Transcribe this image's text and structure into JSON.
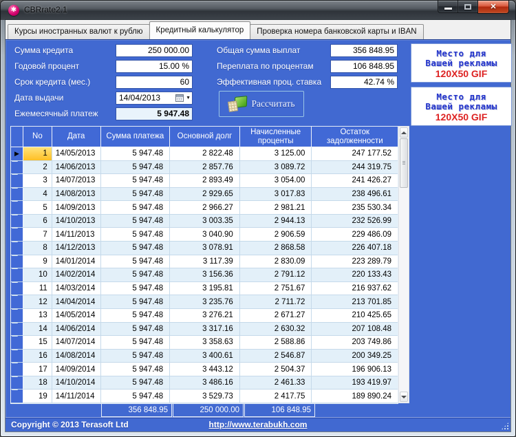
{
  "window": {
    "title": "CBRrate2.1"
  },
  "tabs": [
    {
      "label": "Курсы иностранных валют к рублю",
      "active": false
    },
    {
      "label": "Кредитный калькулятор",
      "active": true
    },
    {
      "label": "Проверка номера банковской карты и IBAN",
      "active": false
    }
  ],
  "form": {
    "left": [
      {
        "label": "Сумма кредита",
        "value": "250 000.00"
      },
      {
        "label": "Годовой процент",
        "value": "15.00 %"
      },
      {
        "label": "Срок кредита (мес.)",
        "value": "60"
      },
      {
        "label": "Дата выдачи",
        "value": "14/04/2013"
      },
      {
        "label": "Ежемесячный платеж",
        "value": "5 947.48"
      }
    ],
    "right": [
      {
        "label": "Общая сумма выплат",
        "value": "356 848.95"
      },
      {
        "label": "Переплата по процентам",
        "value": "106 848.95"
      },
      {
        "label": "Эффективная проц. ставка",
        "value": "42.74 %"
      }
    ],
    "calculate_label": "Рассчитать"
  },
  "ads": {
    "line1": "Место для",
    "line2": "Вашей рекламы",
    "line3": "120X50 GIF"
  },
  "table": {
    "columns": [
      "No",
      "Дата",
      "Сумма платежа",
      "Основной долг",
      "Начисленные проценты",
      "Остаток задолженности"
    ],
    "rows": [
      [
        "1",
        "14/05/2013",
        "5 947.48",
        "2 822.48",
        "3 125.00",
        "247 177.52"
      ],
      [
        "2",
        "14/06/2013",
        "5 947.48",
        "2 857.76",
        "3 089.72",
        "244 319.75"
      ],
      [
        "3",
        "14/07/2013",
        "5 947.48",
        "2 893.49",
        "3 054.00",
        "241 426.27"
      ],
      [
        "4",
        "14/08/2013",
        "5 947.48",
        "2 929.65",
        "3 017.83",
        "238 496.61"
      ],
      [
        "5",
        "14/09/2013",
        "5 947.48",
        "2 966.27",
        "2 981.21",
        "235 530.34"
      ],
      [
        "6",
        "14/10/2013",
        "5 947.48",
        "3 003.35",
        "2 944.13",
        "232 526.99"
      ],
      [
        "7",
        "14/11/2013",
        "5 947.48",
        "3 040.90",
        "2 906.59",
        "229 486.09"
      ],
      [
        "8",
        "14/12/2013",
        "5 947.48",
        "3 078.91",
        "2 868.58",
        "226 407.18"
      ],
      [
        "9",
        "14/01/2014",
        "5 947.48",
        "3 117.39",
        "2 830.09",
        "223 289.79"
      ],
      [
        "10",
        "14/02/2014",
        "5 947.48",
        "3 156.36",
        "2 791.12",
        "220 133.43"
      ],
      [
        "11",
        "14/03/2014",
        "5 947.48",
        "3 195.81",
        "2 751.67",
        "216 937.62"
      ],
      [
        "12",
        "14/04/2014",
        "5 947.48",
        "3 235.76",
        "2 711.72",
        "213 701.85"
      ],
      [
        "13",
        "14/05/2014",
        "5 947.48",
        "3 276.21",
        "2 671.27",
        "210 425.65"
      ],
      [
        "14",
        "14/06/2014",
        "5 947.48",
        "3 317.16",
        "2 630.32",
        "207 108.48"
      ],
      [
        "15",
        "14/07/2014",
        "5 947.48",
        "3 358.63",
        "2 588.86",
        "203 749.86"
      ],
      [
        "16",
        "14/08/2014",
        "5 947.48",
        "3 400.61",
        "2 546.87",
        "200 349.25"
      ],
      [
        "17",
        "14/09/2014",
        "5 947.48",
        "3 443.12",
        "2 504.37",
        "196 906.13"
      ],
      [
        "18",
        "14/10/2014",
        "5 947.48",
        "3 486.16",
        "2 461.33",
        "193 419.97"
      ],
      [
        "19",
        "14/11/2014",
        "5 947.48",
        "3 529.73",
        "2 417.75",
        "189 890.24"
      ]
    ]
  },
  "totals": [
    "356 848.95",
    "250 000.00",
    "106 848.95"
  ],
  "statusbar": {
    "copyright": "Copyright © 2013 Terasoft Ltd",
    "link": "http://www.terabukh.com"
  },
  "colors": {
    "panel_blue": "#4169d1",
    "header_blue": "#4169d6",
    "selected_cell_yellow": "#ffc938",
    "ad_blue": "#2233cc",
    "ad_red": "#dd2222",
    "row_alt": "#e3f0f9"
  }
}
